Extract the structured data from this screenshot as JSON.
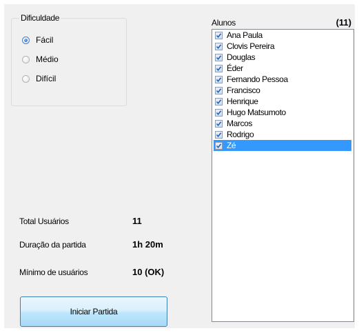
{
  "difficulty": {
    "legend": "Dificuldade",
    "options": [
      {
        "label": "Fácil",
        "checked": true
      },
      {
        "label": "Médio",
        "checked": false
      },
      {
        "label": "Difícil",
        "checked": false
      }
    ]
  },
  "students": {
    "title": "Alunos",
    "count": "(11)",
    "items": [
      {
        "label": "Ana Paula",
        "checked": true,
        "selected": false
      },
      {
        "label": "Clovis Pereira",
        "checked": true,
        "selected": false
      },
      {
        "label": "Douglas",
        "checked": true,
        "selected": false
      },
      {
        "label": "Éder",
        "checked": true,
        "selected": false
      },
      {
        "label": "Fernando Pessoa",
        "checked": true,
        "selected": false
      },
      {
        "label": "Francisco",
        "checked": true,
        "selected": false
      },
      {
        "label": "Henrique",
        "checked": true,
        "selected": false
      },
      {
        "label": "Hugo Matsumoto",
        "checked": true,
        "selected": false
      },
      {
        "label": "Marcos",
        "checked": true,
        "selected": false
      },
      {
        "label": "Rodrigo",
        "checked": true,
        "selected": false
      },
      {
        "label": "Zé",
        "checked": true,
        "selected": true
      }
    ]
  },
  "stats": {
    "total_users_label": "Total Usuários",
    "total_users_value": "11",
    "duration_label": "Duração da partida",
    "duration_value": "1h 20m",
    "min_users_label": "Mínimo de usuários",
    "min_users_value": "10 (OK)"
  },
  "actions": {
    "start_label": "Iniciar Partida"
  },
  "colors": {
    "selection": "#3399ff",
    "check": "#2a5cb0"
  }
}
